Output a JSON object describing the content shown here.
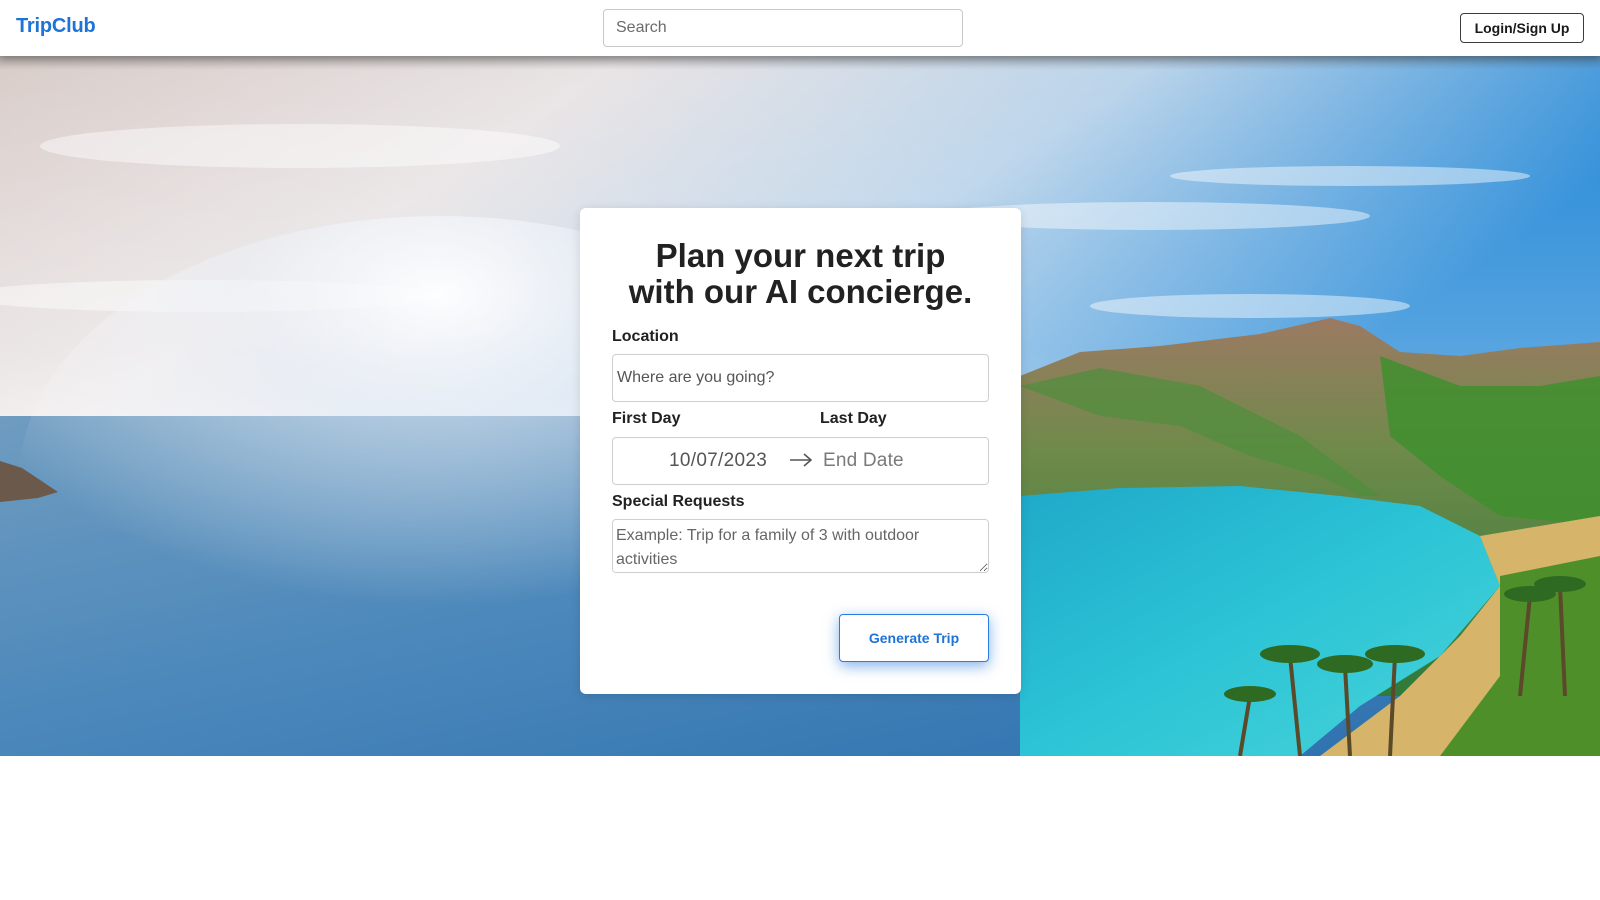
{
  "header": {
    "brand": "TripClub",
    "search_placeholder": "Search",
    "login_label": "Login/Sign Up"
  },
  "planner": {
    "title_line1": "Plan your next trip",
    "title_line2": "with our AI concierge.",
    "location_label": "Location",
    "location_placeholder": "Where are you going?",
    "first_day_label": "First Day",
    "last_day_label": "Last Day",
    "start_date": "10/07/2023",
    "end_date_placeholder": "End Date",
    "requests_label": "Special Requests",
    "requests_placeholder": "Example: Trip for a family of 3 with outdoor activities",
    "generate_label": "Generate Trip"
  },
  "colors": {
    "brand": "#1e73d6",
    "accent": "#2b7be4"
  },
  "icons": {
    "date_separator": "arrow-right-icon"
  }
}
